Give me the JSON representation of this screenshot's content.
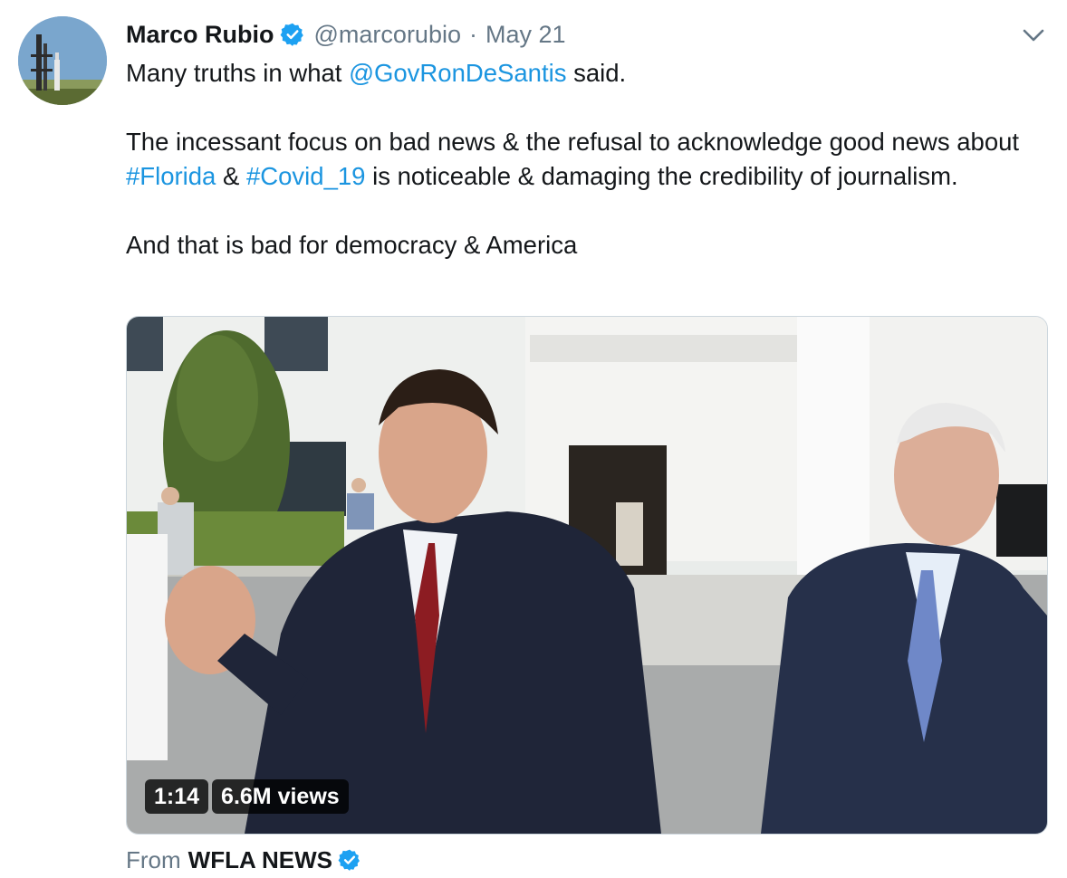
{
  "tweet": {
    "author_name": "Marco Rubio",
    "handle": "@marcorubio",
    "separator": "·",
    "date": "May 21",
    "text": {
      "line1_before": "Many truths in what ",
      "mention": "@GovRonDeSantis",
      "line1_after": " said.",
      "para2_part1": "The incessant focus on bad news & the refusal to acknowledge good news about ",
      "hashtag1": "#Florida",
      "para2_part2": " & ",
      "hashtag2": "#Covid_19",
      "para2_part3": " is noticeable & damaging the credibility of journalism.",
      "para3": "And that is bad for democracy & America"
    }
  },
  "video": {
    "duration": "1:14",
    "views": "6.6M views"
  },
  "source": {
    "from_label": "From",
    "name": "WFLA NEWS"
  },
  "colors": {
    "link": "#1b95e0",
    "secondary": "#657786",
    "verified": "#1da1f2"
  },
  "icons": {
    "verified": "verified-badge-icon",
    "chevron": "chevron-down-icon"
  }
}
